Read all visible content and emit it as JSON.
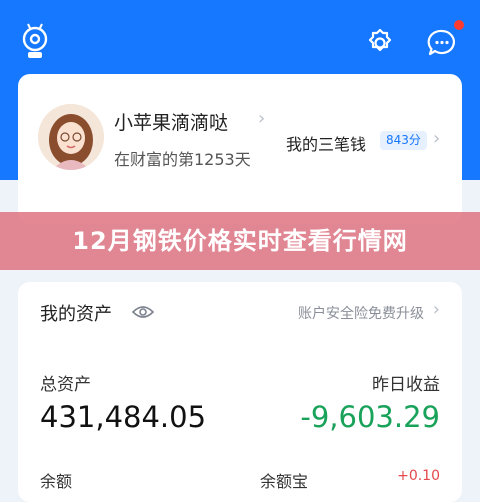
{
  "header": {
    "icons": [
      "logo-icon",
      "gear-icon",
      "chat-icon"
    ],
    "notification": true,
    "brand_color": "#1677ff"
  },
  "profile": {
    "username": "小苹果滴滴哒",
    "days_text": "在财富的第1253天",
    "money_label": "我的三笔钱",
    "score": "843分"
  },
  "overlay": {
    "title": "12月钢铁价格实时查看行情网"
  },
  "assets": {
    "title": "我的资产",
    "promo": "账户安全险免费升级",
    "total_label": "总资产",
    "total_value": "431,484.05",
    "yesterday_label": "昨日收益",
    "yesterday_value": "-9,603.29",
    "gain_color": "#19a25a",
    "cut_label_left": "余额",
    "cut_label_mid": "余额宝",
    "cut_value_right": "+0.10"
  }
}
